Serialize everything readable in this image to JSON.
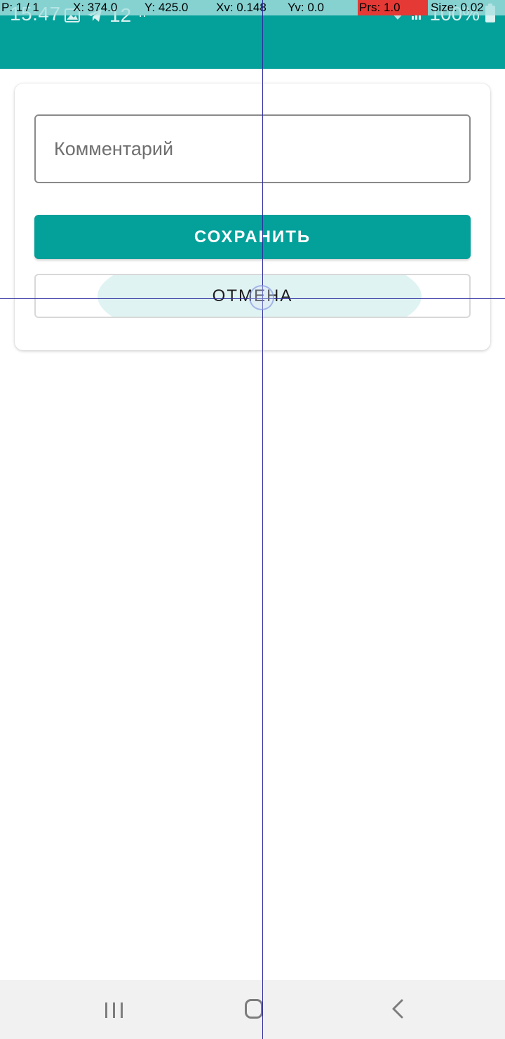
{
  "status_bar": {
    "time": "15:47",
    "notification_count": "12",
    "battery": "100%"
  },
  "pointer_overlay": {
    "pointer": "P: 1 / 1",
    "x": "X: 374.0",
    "y": "Y: 425.0",
    "xv": "Xv: 0.148",
    "yv": "Yv: 0.0",
    "prs": "Prs: 1.0",
    "size": "Size: 0.02"
  },
  "form": {
    "comment_placeholder": "Комментарий",
    "comment_value": "",
    "save_label": "СОХРАНИТЬ",
    "cancel_label": "ОТМЕНА"
  },
  "nav": {
    "recent": "recent-apps-icon",
    "home": "home-icon",
    "back": "back-icon"
  },
  "colors": {
    "accent": "#04a09a",
    "overlay_bg": "#aae0e0",
    "pressure": "#e53935"
  }
}
